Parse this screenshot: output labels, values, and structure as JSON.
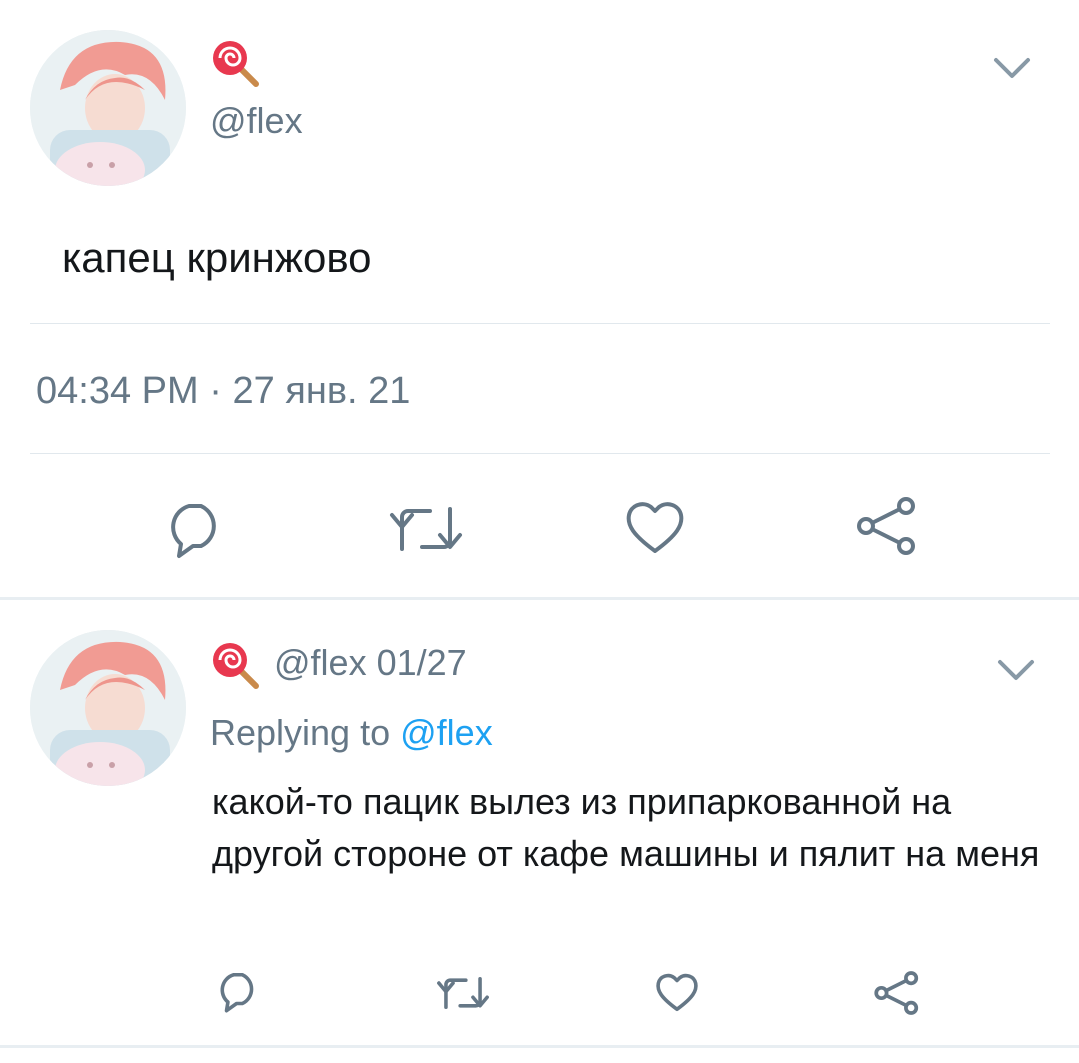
{
  "main_tweet": {
    "handle": "@flex",
    "text": "капец кринжово",
    "time": "04:34 PM",
    "separator": "·",
    "date": "27 янв. 21",
    "avatar_icon": "user-avatar",
    "badge_icon": "lollipop-icon"
  },
  "reply_tweet": {
    "handle": "@flex",
    "date": "01/27",
    "replying_prefix": "Replying to",
    "replying_handle": "@flex",
    "text": "какой-то пацик вылез из припаркованной на другой стороне от кафе машины и пялит на меня",
    "avatar_icon": "user-avatar",
    "badge_icon": "lollipop-icon"
  },
  "actions": [
    "reply-icon",
    "retweet-icon",
    "like-icon",
    "share-icon"
  ],
  "colors": {
    "text": "#14171a",
    "secondary": "#657786",
    "link": "#1da1f2",
    "divider": "#e1e8ed"
  }
}
